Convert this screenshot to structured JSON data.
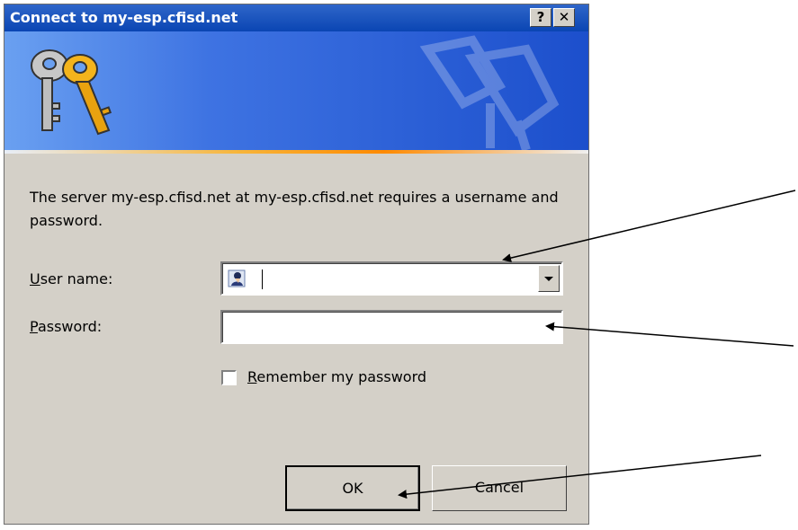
{
  "window": {
    "title": "Connect to my-esp.cfisd.net",
    "help_glyph": "?",
    "close_glyph": "✕"
  },
  "banner": {
    "icon": "keys-icon",
    "watermark_icon": "keys-watermark-icon"
  },
  "form": {
    "message": "The server my-esp.cfisd.net at my-esp.cfisd.net requires a username and password.",
    "username": {
      "label_ul": "U",
      "label_rest": "ser name:",
      "value": ""
    },
    "password": {
      "label_ul": "P",
      "label_rest": "assword:",
      "value": ""
    },
    "remember": {
      "label_ul": "R",
      "label_rest": "emember my password",
      "checked": false
    }
  },
  "buttons": {
    "ok": "OK",
    "cancel": "Cancel"
  },
  "annotations": {
    "arrow_color": "#000000",
    "count": 3
  }
}
